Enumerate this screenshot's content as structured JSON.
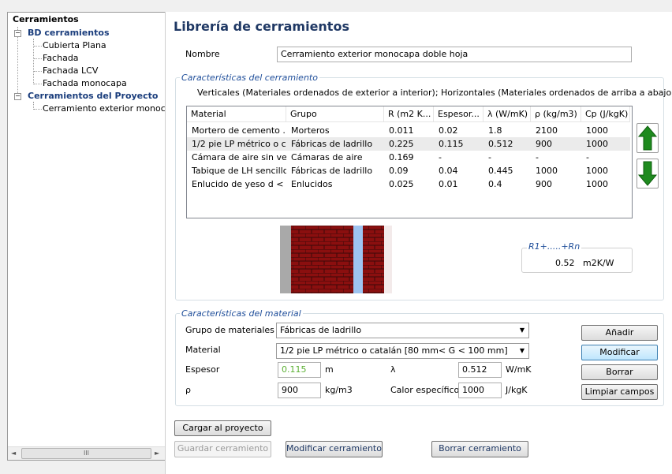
{
  "tree": {
    "root": "Cerramientos",
    "bd": {
      "label": "BD cerramientos",
      "children": [
        "Cubierta Plana",
        "Fachada",
        "Fachada LCV",
        "Fachada monocapa"
      ]
    },
    "proyecto": {
      "label": "Cerramientos del Proyecto",
      "children": [
        "Cerramiento exterior monocapa"
      ]
    },
    "scroll_thumb": "III"
  },
  "title": "Librería de cerramientos",
  "nombre": {
    "label": "Nombre",
    "value": "Cerramiento exterior monocapa doble hoja"
  },
  "caract_cerramiento": {
    "legend": "Características del cerramiento",
    "orientation_text": "Verticales (Materiales ordenados de exterior a interior);  Horizontales (Materiales ordenados de arriba a abajo)",
    "columns": [
      "Material",
      "Grupo",
      "R (m2 K...",
      "Espesor...",
      "λ (W/mK)",
      "ρ (kg/m3)",
      "Cp (J/kgK)"
    ],
    "rows": [
      [
        "Mortero de cemento ...",
        "Morteros",
        "0.011",
        "0.02",
        "1.8",
        "2100",
        "1000"
      ],
      [
        "1/2 pie LP métrico o c...",
        "Fábricas de ladrillo",
        "0.225",
        "0.115",
        "0.512",
        "900",
        "1000"
      ],
      [
        "Cámara de aire sin ve...",
        "Cámaras de aire",
        "0.169",
        "-",
        "-",
        "-",
        "-"
      ],
      [
        "Tabique de LH sencillo...",
        "Fábricas de ladrillo",
        "0.09",
        "0.04",
        "0.445",
        "1000",
        "1000"
      ],
      [
        "Enlucido de yeso d < ...",
        "Enlucidos",
        "0.025",
        "0.01",
        "0.4",
        "900",
        "1000"
      ]
    ],
    "selected_row": 1,
    "sum_label": "R1+.....+Rn",
    "sum_value": "0.52",
    "sum_unit": "m2K/W",
    "up_color": "#1e8a1e",
    "down_color": "#1e8a1e"
  },
  "caract_material": {
    "legend": "Características del material",
    "grupo_label": "Grupo de materiales",
    "grupo_value": "Fábricas de ladrillo",
    "material_label": "Material",
    "material_value": "1/2 pie LP métrico o catalán [80 mm< G < 100 mm]",
    "espesor_label": "Espesor",
    "espesor_value": "0.115",
    "espesor_unit": "m",
    "lambda_label": "λ",
    "lambda_value": "0.512",
    "lambda_unit": "W/mK",
    "rho_label": "ρ",
    "rho_value": "900",
    "rho_unit": "kg/m3",
    "calor_label": "Calor específico",
    "calor_value": "1000",
    "calor_unit": "J/kgK",
    "buttons": {
      "anadir": "Añadir",
      "modificar": "Modificar",
      "borrar": "Borrar",
      "limpiar": "Limpiar campos"
    }
  },
  "bottom": {
    "cargar": "Cargar al proyecto",
    "guardar": "Guardar cerramiento",
    "modificar": "Modificar cerramiento",
    "borrar": "Borrar cerramiento"
  }
}
